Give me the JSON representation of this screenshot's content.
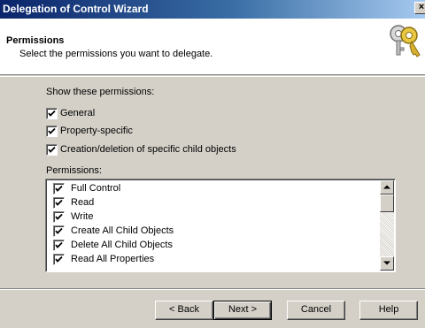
{
  "window": {
    "title": "Delegation of Control Wizard",
    "close_glyph": "×"
  },
  "header": {
    "title": "Permissions",
    "subtitle": "Select the permissions you want to delegate.",
    "icon": "keys-icon"
  },
  "show_label": "Show these permissions:",
  "filters": [
    {
      "label": "General",
      "checked": true
    },
    {
      "label": "Property-specific",
      "checked": true
    },
    {
      "label": "Creation/deletion of specific child objects",
      "checked": true
    }
  ],
  "permissions_label": "Permissions:",
  "permissions": [
    {
      "label": "Full Control",
      "checked": true
    },
    {
      "label": "Read",
      "checked": true
    },
    {
      "label": "Write",
      "checked": true
    },
    {
      "label": "Create All Child Objects",
      "checked": true
    },
    {
      "label": "Delete All Child Objects",
      "checked": true
    },
    {
      "label": "Read All Properties",
      "checked": true
    }
  ],
  "buttons": {
    "back": "< Back",
    "next": "Next >",
    "cancel": "Cancel",
    "help": "Help"
  }
}
